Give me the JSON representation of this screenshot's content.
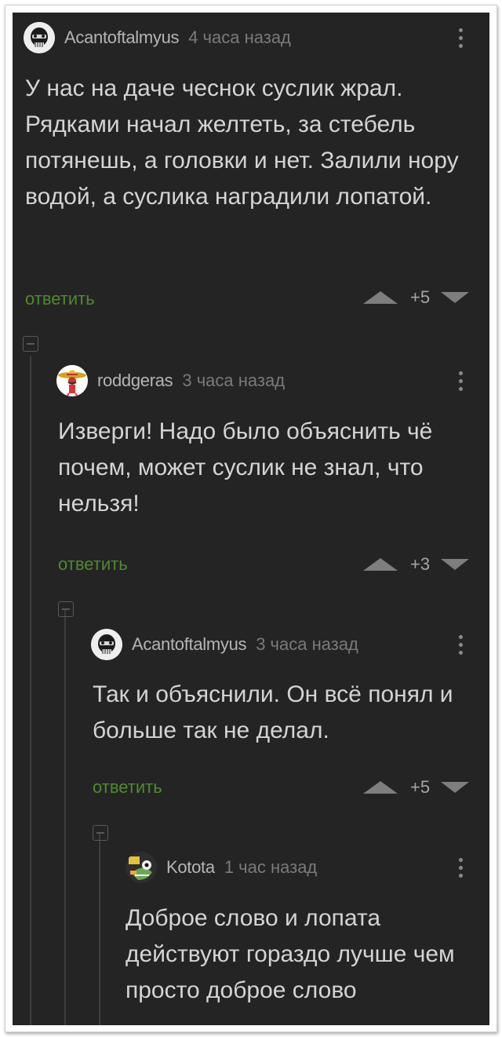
{
  "comments": [
    {
      "author": "Acantoftalmyus",
      "time": "4 часа назад",
      "text": "У нас на даче чеснок суслик жрал. Рядками начал желтеть, за стебель потянешь, а головки и нет. Залили нору водой, а суслика наградили лопатой.",
      "reply_label": "ответить",
      "score": "+5"
    },
    {
      "author": "roddgeras",
      "time": "3 часа назад",
      "text": "Изверги! Надо было объяснить чё почем, может суслик не знал, что нельзя!",
      "reply_label": "ответить",
      "score": "+3"
    },
    {
      "author": "Acantoftalmyus",
      "time": "3 часа назад",
      "text": "Так и объяснили. Он всё понял и больше так не делал.",
      "reply_label": "ответить",
      "score": "+5"
    },
    {
      "author": "Kotota",
      "time": "1 час назад",
      "text": "Доброе слово и лопата действуют гораздо лучше чем просто доброе слово"
    }
  ],
  "icons": {
    "menu": "more-vertical-icon",
    "upvote": "arrow-up-triangle-icon",
    "downvote": "arrow-down-triangle-icon",
    "collapse": "collapse-minus-icon"
  },
  "colors": {
    "background": "#242424",
    "text": "#d4d4d4",
    "author": "#b5b5b5",
    "time": "#7a7a7a",
    "reply": "#4f8a2e"
  }
}
